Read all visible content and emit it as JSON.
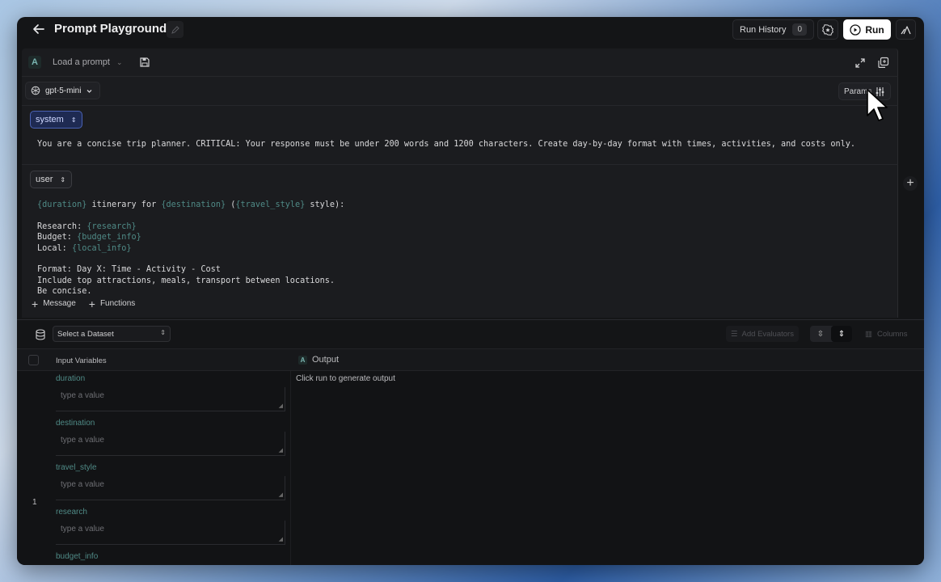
{
  "header": {
    "title": "Prompt Playground",
    "run_history_label": "Run History",
    "run_history_count": "0",
    "run_label": "Run"
  },
  "editor": {
    "load_prompt": "Load a prompt",
    "model": "gpt-5-mini",
    "params_label": "Params",
    "system_role": "system",
    "system_text": "You are a concise trip planner. CRITICAL: Your response must be under 200 words and 1200 characters. Create day-by-day format with times, activities, and costs only.",
    "user_role": "user",
    "user_lines": {
      "l1_a": "{duration}",
      "l1_b": " itinerary for ",
      "l1_c": "{destination}",
      "l1_d": " (",
      "l1_e": "{travel_style}",
      "l1_f": " style):",
      "l3_a": "Research: ",
      "l3_b": "{research}",
      "l4_a": "Budget: ",
      "l4_b": "{budget_info}",
      "l5_a": "Local: ",
      "l5_b": "{local_info}",
      "l7": "Format: Day X: Time - Activity - Cost",
      "l8": "Include top attractions, meals, transport between locations.",
      "l9": "Be concise."
    },
    "add_message": "Message",
    "add_functions": "Functions"
  },
  "dataset": {
    "select_placeholder": "Select a Dataset",
    "add_evaluators": "Add Evaluators",
    "columns": "Columns"
  },
  "table": {
    "col_input": "Input Variables",
    "col_output": "Output",
    "row_number": "1",
    "output_placeholder": "Click run to generate output",
    "variables": [
      {
        "name": "duration",
        "placeholder": "type a value"
      },
      {
        "name": "destination",
        "placeholder": "type a value"
      },
      {
        "name": "travel_style",
        "placeholder": "type a value"
      },
      {
        "name": "research",
        "placeholder": "type a value"
      },
      {
        "name": "budget_info",
        "placeholder": "type a value"
      }
    ]
  },
  "colors": {
    "accent_teal": "#4f8a86",
    "system_role_bg": "#1e2a52",
    "run_button_bg": "#ffffff"
  }
}
